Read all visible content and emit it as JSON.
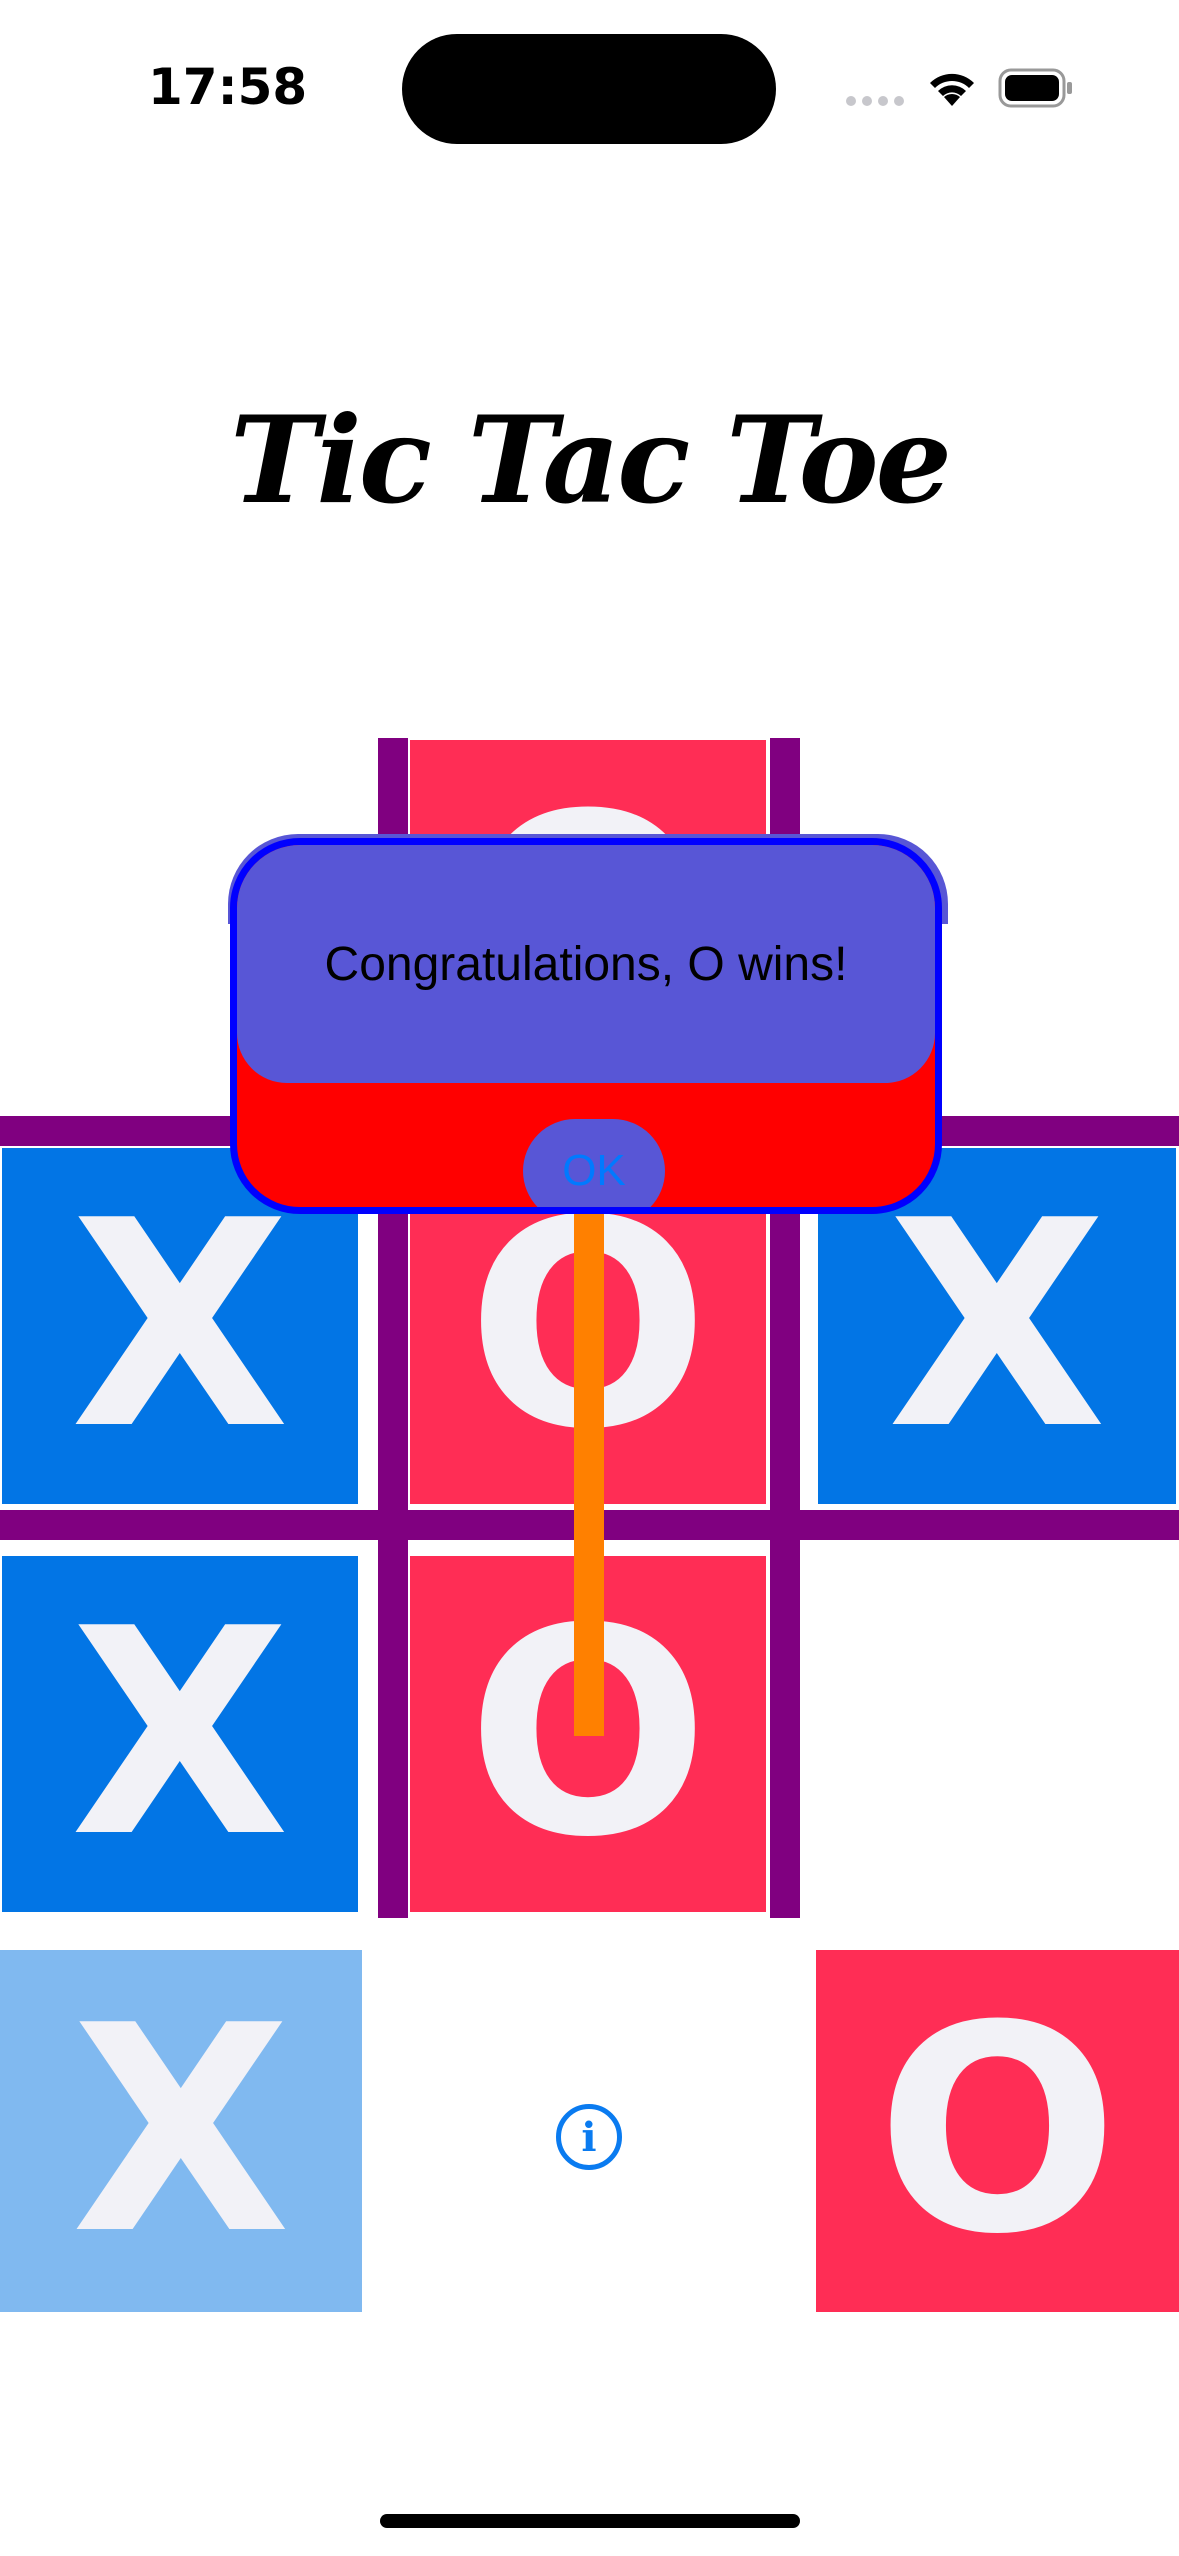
{
  "status_bar": {
    "time": "17:58"
  },
  "title": "Tic Tac Toe",
  "board": {
    "cells": [
      {
        "mark": "O",
        "color": "#ff2d55",
        "faded": false
      },
      {
        "mark": "",
        "color": "",
        "faded": false
      },
      {
        "mark": "X",
        "color": "#0275e5",
        "faded": false
      },
      {
        "mark": "O",
        "color": "#ff2d55",
        "faded": false
      },
      {
        "mark": "X",
        "color": "#0275e5",
        "faded": false
      },
      {
        "mark": "X",
        "color": "#0275e5",
        "faded": false
      },
      {
        "mark": "O",
        "color": "#ff2d55",
        "faded": false
      },
      {
        "mark": "X",
        "color": "#80b9f0",
        "faded": true
      },
      {
        "mark": "O",
        "color": "#ff2d55",
        "faded": false
      }
    ],
    "grid_color": "#800080",
    "win_line_color": "#ff8000"
  },
  "alert": {
    "message": "Congratulations, O wins!",
    "ok_label": "OK",
    "border_color": "#0000ff",
    "top_color": "#5856d6",
    "bottom_color": "#ff0000"
  },
  "info_icon": "info-circle-icon"
}
